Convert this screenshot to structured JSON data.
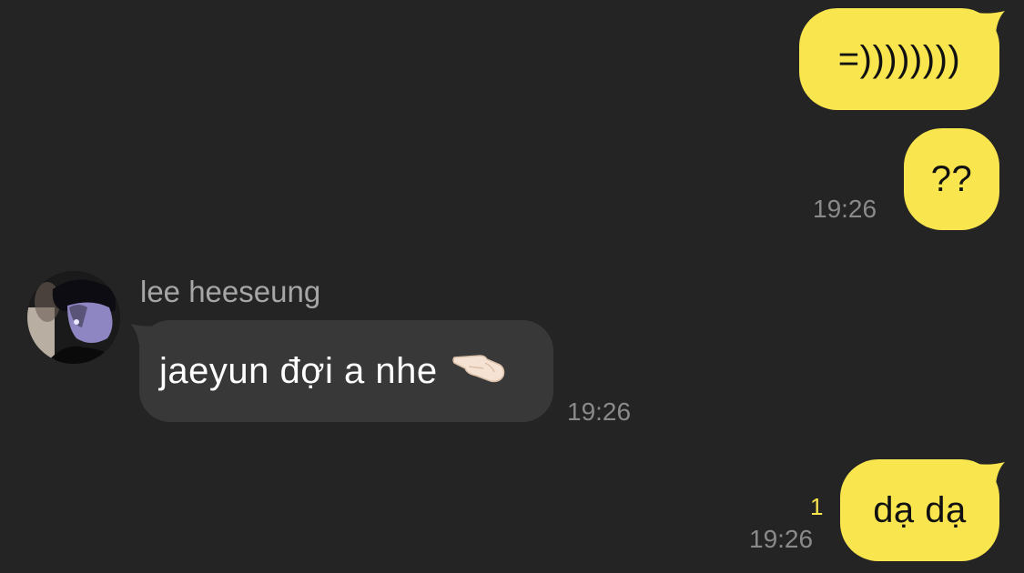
{
  "colors": {
    "background": "#242424",
    "outgoing_bubble": "#F9E54E",
    "incoming_bubble": "#383838",
    "timestamp": "#8A8A8A",
    "unread_count": "#F9E54E",
    "sender_name": "#A6A6A6"
  },
  "messages": [
    {
      "direction": "outgoing",
      "text": "=))))))))"
    },
    {
      "direction": "outgoing",
      "text": "??",
      "time": "19:26"
    },
    {
      "direction": "incoming",
      "sender": "lee heeseung",
      "text": "jaeyun đợi a nhe",
      "emoji_icon": "pinching-hand-icon",
      "time": "19:26"
    },
    {
      "direction": "outgoing",
      "text": "dạ dạ",
      "time": "19:26",
      "unread_count": "1"
    }
  ]
}
